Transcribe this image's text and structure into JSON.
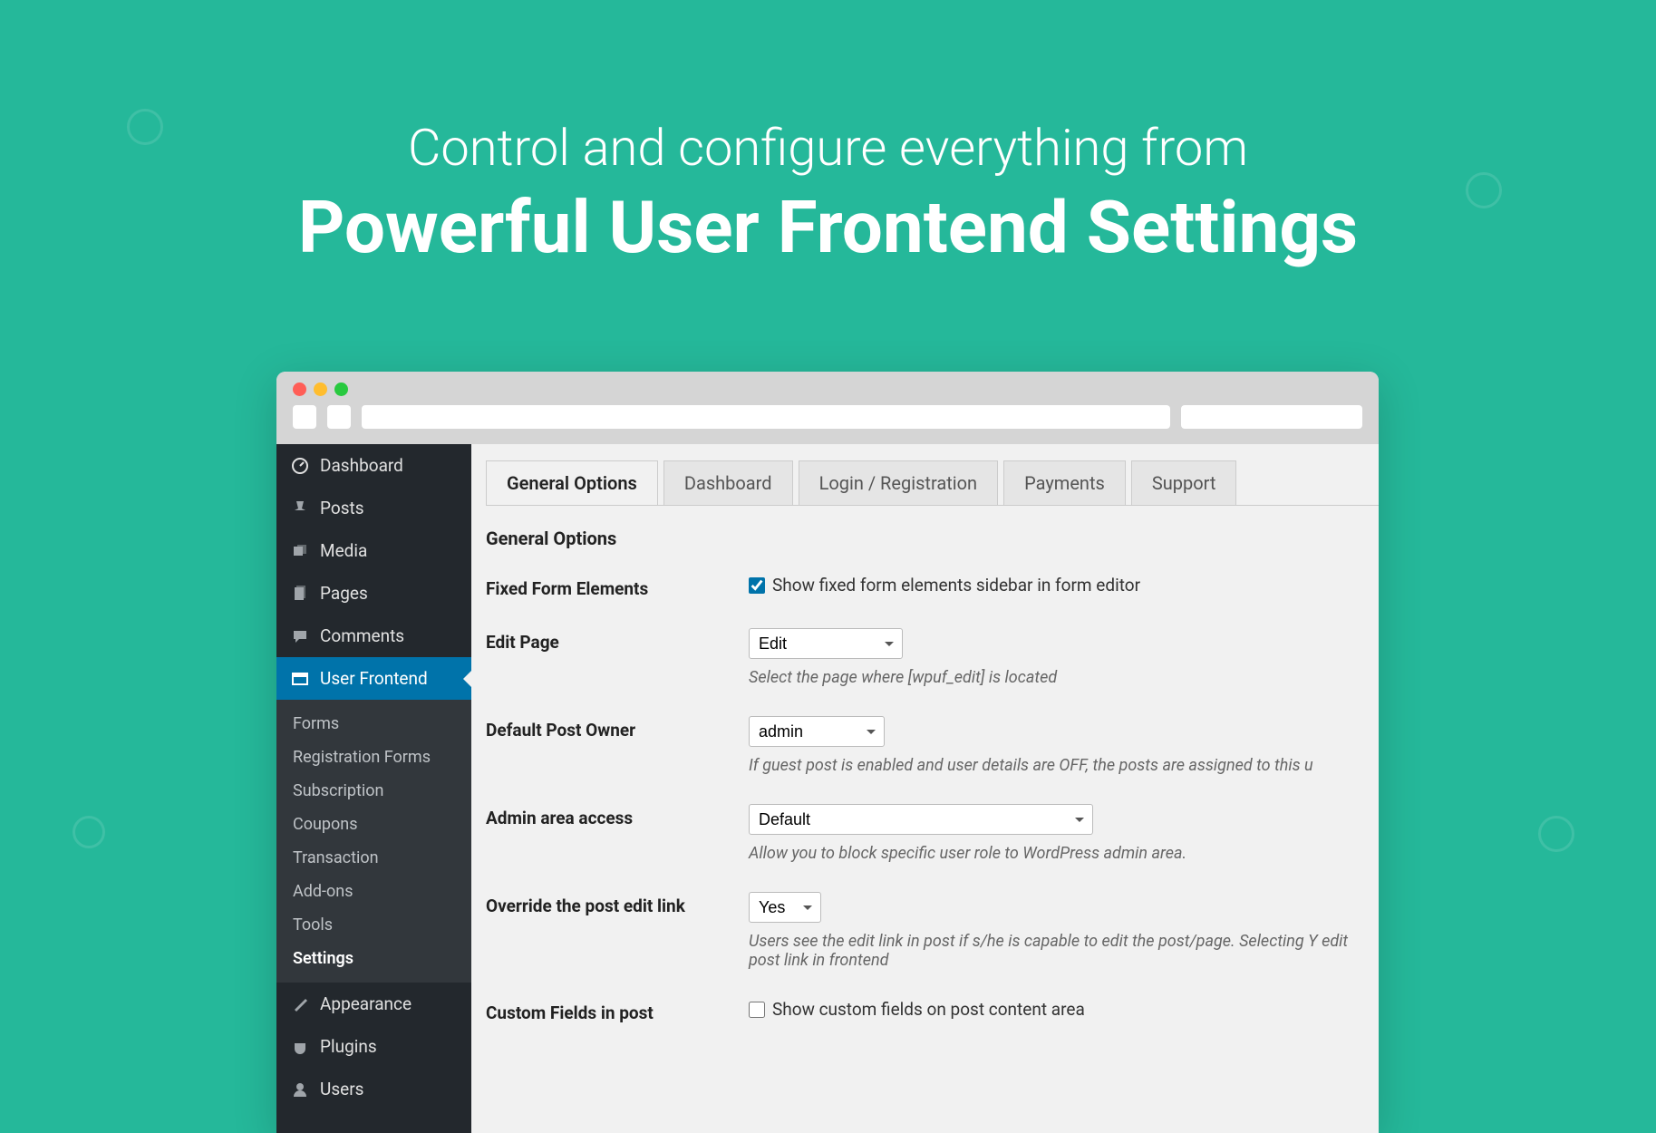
{
  "headline": {
    "line1": "Control and configure everything from",
    "line2": "Powerful User Frontend Settings"
  },
  "sidebar": {
    "items": [
      {
        "label": "Dashboard",
        "icon": "dashboard"
      },
      {
        "label": "Posts",
        "icon": "pin"
      },
      {
        "label": "Media",
        "icon": "media"
      },
      {
        "label": "Pages",
        "icon": "pages"
      },
      {
        "label": "Comments",
        "icon": "comment"
      },
      {
        "label": "User Frontend",
        "icon": "frontend"
      },
      {
        "label": "Appearance",
        "icon": "brush"
      },
      {
        "label": "Plugins",
        "icon": "plug"
      },
      {
        "label": "Users",
        "icon": "user"
      }
    ],
    "sub": [
      {
        "label": "Forms"
      },
      {
        "label": "Registration Forms"
      },
      {
        "label": "Subscription"
      },
      {
        "label": "Coupons"
      },
      {
        "label": "Transaction"
      },
      {
        "label": "Add-ons"
      },
      {
        "label": "Tools"
      },
      {
        "label": "Settings"
      }
    ]
  },
  "tabs": [
    {
      "label": "General Options"
    },
    {
      "label": "Dashboard"
    },
    {
      "label": "Login / Registration"
    },
    {
      "label": "Payments"
    },
    {
      "label": "Support"
    }
  ],
  "section_title": "General Options",
  "fields": {
    "fixed_form": {
      "label": "Fixed Form Elements",
      "checkbox_label": "Show fixed form elements sidebar in form editor",
      "checked": true
    },
    "edit_page": {
      "label": "Edit Page",
      "value": "Edit",
      "help": "Select the page where [wpuf_edit] is located"
    },
    "default_owner": {
      "label": "Default Post Owner",
      "value": "admin",
      "help": "If guest post is enabled and user details are OFF, the posts are assigned to this u"
    },
    "admin_access": {
      "label": "Admin area access",
      "value": "Default",
      "help": "Allow you to block specific user role to WordPress admin area."
    },
    "override_edit": {
      "label": "Override the post edit link",
      "value": "Yes",
      "help": "Users see the edit link in post if s/he is capable to edit the post/page. Selecting Y edit post link in frontend"
    },
    "custom_fields": {
      "label": "Custom Fields in post",
      "checkbox_label": "Show custom fields on post content area",
      "checked": false
    }
  }
}
